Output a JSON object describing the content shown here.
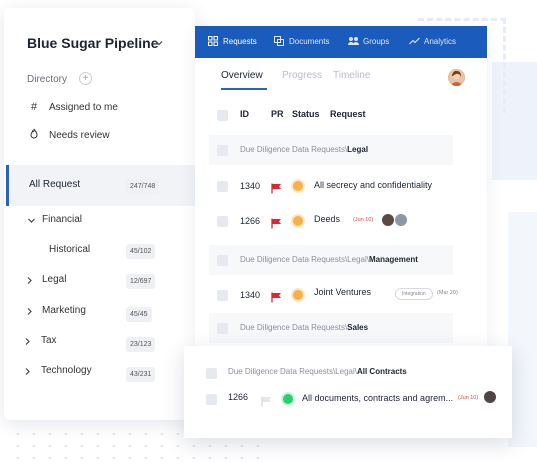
{
  "colors": {
    "nav_bg": "#1b5bbb",
    "accent": "#2a62bf",
    "flag_red": "#e0262f",
    "dot_orange": "#f6b14a",
    "dot_green": "#2ecc71"
  },
  "sidebar": {
    "title": "Blue Sugar Pipeline",
    "directory_label": "Directory",
    "quick_links": [
      {
        "label": "Assigned to me",
        "icon": "hash-icon"
      },
      {
        "label": "Needs review",
        "icon": "flame-icon"
      }
    ],
    "active_item": {
      "label": "All Request",
      "count": "247/748"
    },
    "tree": [
      {
        "label": "Financial",
        "count": "",
        "chevron": "chevron-down-icon"
      },
      {
        "label": "Historical",
        "count": "45/102",
        "chevron": ""
      },
      {
        "label": "Legal",
        "count": "12/697",
        "chevron": "chevron-right-icon"
      },
      {
        "label": "Marketing",
        "count": "45/45",
        "chevron": "chevron-right-icon"
      },
      {
        "label": "Tax",
        "count": "23/123",
        "chevron": "chevron-right-icon"
      },
      {
        "label": "Technology",
        "count": "43/231",
        "chevron": "chevron-right-icon"
      }
    ]
  },
  "topnav": {
    "items": [
      {
        "label": "Requests",
        "icon": "grid-icon"
      },
      {
        "label": "Documents",
        "icon": "documents-icon"
      },
      {
        "label": "Groups",
        "icon": "groups-icon"
      },
      {
        "label": "Analytics",
        "icon": "analytics-icon"
      }
    ]
  },
  "tabs": [
    "Overview",
    "Progress",
    "Timeline"
  ],
  "table": {
    "headers": {
      "id": "ID",
      "pr": "PR",
      "status": "Status",
      "request": "Request"
    },
    "groups": [
      {
        "path": "Due Diligence Data Requests\\",
        "bold": "Legal"
      },
      {
        "path": "Due Diligence Data Requests\\Legal\\",
        "bold": "Management"
      },
      {
        "path": "Due Diligence Data Requests\\",
        "bold": "Sales"
      }
    ],
    "rows": [
      {
        "id": "1340",
        "request": "All secrecy and confidentiality"
      },
      {
        "id": "1266",
        "request": "Deeds",
        "tag": "(Jun 10)"
      },
      {
        "id": "1340",
        "request": "Joint Ventures",
        "pill": "Integration",
        "date": "(Mar 20)"
      }
    ]
  },
  "float_card": {
    "group": {
      "path": "Due Diligence Data Requests\\Legal\\",
      "bold": "All Contracts"
    },
    "row": {
      "id": "1266",
      "request": "All documents, contracts and agrem...",
      "tag": "(Jun 10)"
    }
  }
}
